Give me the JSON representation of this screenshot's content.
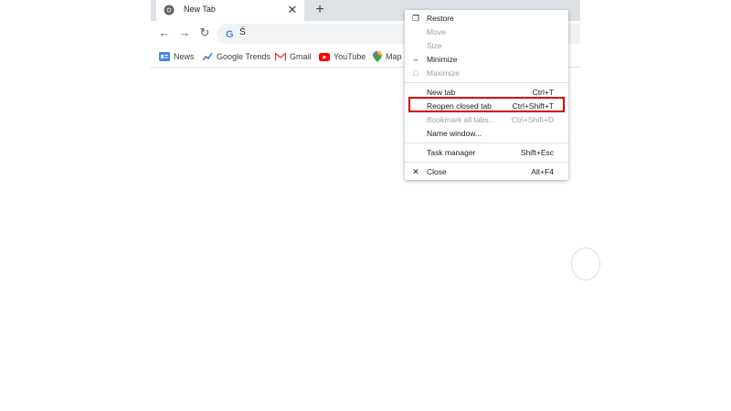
{
  "tab": {
    "title": "New Tab",
    "close": "✕",
    "new_tab": "+"
  },
  "toolbar": {
    "back": "←",
    "forward": "→",
    "reload": "↻",
    "omnibox_text": "Ś"
  },
  "bookmarks": [
    {
      "label": "News",
      "icon": "news-icon"
    },
    {
      "label": "Google Trends",
      "icon": "trends-icon"
    },
    {
      "label": "Gmail",
      "icon": "gmail-icon"
    },
    {
      "label": "YouTube",
      "icon": "youtube-icon"
    },
    {
      "label": "Map",
      "icon": "maps-icon"
    }
  ],
  "colors": {
    "highlight": "#d50000",
    "tabstrip": "#dee1e6"
  },
  "menu": {
    "items": [
      {
        "label": "Restore",
        "shortcut": "",
        "icon": "restore-icon",
        "disabled": false
      },
      {
        "label": "Move",
        "shortcut": "",
        "icon": "",
        "disabled": true
      },
      {
        "label": "Size",
        "shortcut": "",
        "icon": "",
        "disabled": true
      },
      {
        "label": "Minimize",
        "shortcut": "",
        "icon": "minimize-icon",
        "disabled": false
      },
      {
        "label": "Maximize",
        "shortcut": "",
        "icon": "maximize-icon",
        "disabled": true
      },
      {
        "label": "New tab",
        "shortcut": "Ctrl+T",
        "icon": "",
        "disabled": false
      },
      {
        "label": "Reopen closed tab",
        "shortcut": "Ctrl+Shift+T",
        "icon": "",
        "disabled": false,
        "highlighted": true
      },
      {
        "label": "Bookmark all tabs...",
        "shortcut": "Ctrl+Shift+D",
        "icon": "",
        "disabled": true
      },
      {
        "label": "Name window...",
        "shortcut": "",
        "icon": "",
        "disabled": false
      },
      {
        "label": "Task manager",
        "shortcut": "Shift+Esc",
        "icon": "",
        "disabled": false
      },
      {
        "label": "Close",
        "shortcut": "Alt+F4",
        "icon": "close-icon",
        "disabled": false
      }
    ]
  }
}
